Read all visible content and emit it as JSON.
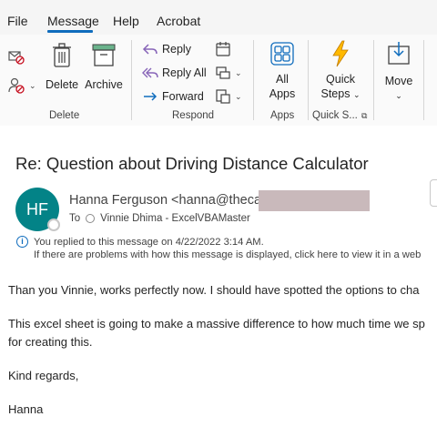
{
  "menu": {
    "tabs": [
      "File",
      "Message",
      "Help",
      "Acrobat"
    ],
    "active_tab": "Message"
  },
  "ribbon": {
    "delete_group": {
      "label": "Delete",
      "delete_label": "Delete",
      "archive_label": "Archive"
    },
    "respond_group": {
      "label": "Respond",
      "reply_label": "Reply",
      "reply_all_label": "Reply All",
      "forward_label": "Forward"
    },
    "apps_group": {
      "label": "Apps",
      "all_apps_line1": "All",
      "all_apps_line2": "Apps"
    },
    "quick_steps_group": {
      "label": "Quick S...",
      "line1": "Quick",
      "line2": "Steps"
    },
    "move_group": {
      "move_label": "Move"
    }
  },
  "message": {
    "subject": "Re: Question about Driving Distance Calculator",
    "avatar_initials": "HF",
    "sender": "Hanna Ferguson <hanna@theca",
    "to_prefix": "To",
    "recipient": "Vinnie Dhima - ExcelVBAMaster",
    "info_line1": "You replied to this message on 4/22/2022 3:14 AM.",
    "info_line2": "If there are problems with how this message is displayed, click here to view it in a web",
    "body": {
      "p1": "Than you Vinnie, works perfectly now. I should have spotted the options to cha",
      "p2a": "This excel sheet is going to make a massive difference to how much time we sp",
      "p2b": "for creating this.",
      "p3": "Kind regards,",
      "p4": "Hanna"
    }
  },
  "colors": {
    "accent": "#0f6cbd",
    "avatar_bg": "#038387",
    "redaction": "#c9b9bb"
  }
}
